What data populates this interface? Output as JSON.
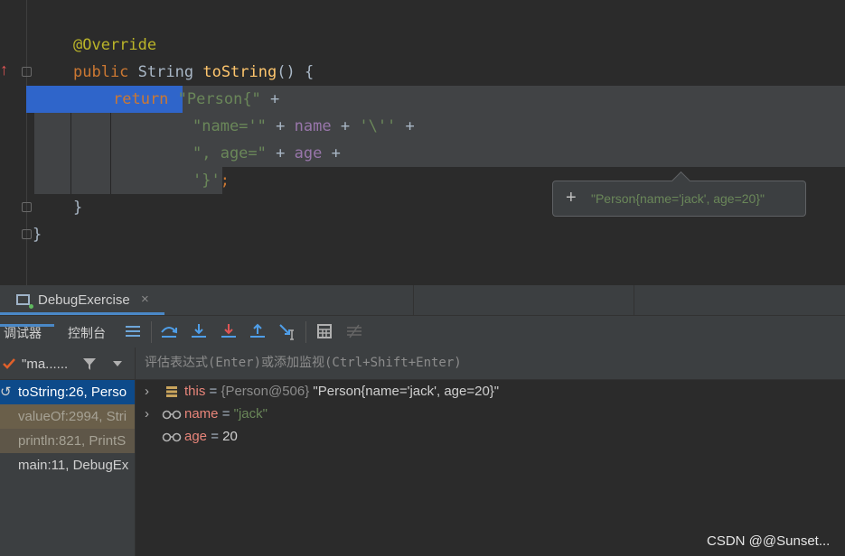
{
  "editor": {
    "line_annotation": "@Override",
    "line_signature": {
      "kw": "public",
      "type": "String",
      "fn": "toString",
      "rest": "() {"
    },
    "line_return": {
      "kw": "return",
      "str": "\"Person{\"",
      "op": "+"
    },
    "line_name": {
      "str1": "\"name='\"",
      "op1": "+",
      "var": "name",
      "op2": "+",
      "str2": "'\\''",
      "op3": "+"
    },
    "line_age": {
      "str": "\", age=\"",
      "op1": "+",
      "var": "age",
      "op2": "+"
    },
    "line_close": {
      "str": "'}'",
      "semi": ";"
    },
    "brace_inner": "}",
    "brace_outer": "}"
  },
  "tooltip": {
    "plus": "+",
    "value": "\"Person{name='jack', age=20}\""
  },
  "tab": {
    "label": "DebugExercise",
    "close": "×"
  },
  "toolbar": {
    "tab_debugger": "调试器",
    "tab_console": "控制台"
  },
  "frames_filter": {
    "thread": "\"ma......"
  },
  "frames": [
    {
      "label": "toString:26, Perso",
      "state": "current"
    },
    {
      "label": "valueOf:2994, Stri",
      "state": "library"
    },
    {
      "label": "println:821, PrintS",
      "state": "library"
    },
    {
      "label": "main:11, DebugEx",
      "state": "normal"
    }
  ],
  "watch": {
    "placeholder": "评估表达式(Enter)或添加监视(Ctrl+Shift+Enter)"
  },
  "variables": [
    {
      "name": "this",
      "eq": " = ",
      "type": "{Person@506}",
      "value": " \"Person{name='jack', age=20}\"",
      "expandable": true,
      "icon": "object-fields-icon"
    },
    {
      "name": "name",
      "eq": " = ",
      "value": "\"jack\"",
      "expandable": true,
      "icon": "watch-glasses-icon"
    },
    {
      "name": "age",
      "eq": " = ",
      "value": "20",
      "expandable": false,
      "icon": "watch-glasses-icon"
    }
  ],
  "watermark": "CSDN @@Sunset...",
  "colors": {
    "keyword": "#cc7832",
    "string": "#6a8759",
    "field": "#9876aa",
    "method": "#ffc66d",
    "annotation": "#bbb529",
    "selection": "#2f65ca",
    "var_name": "#e8857a"
  }
}
